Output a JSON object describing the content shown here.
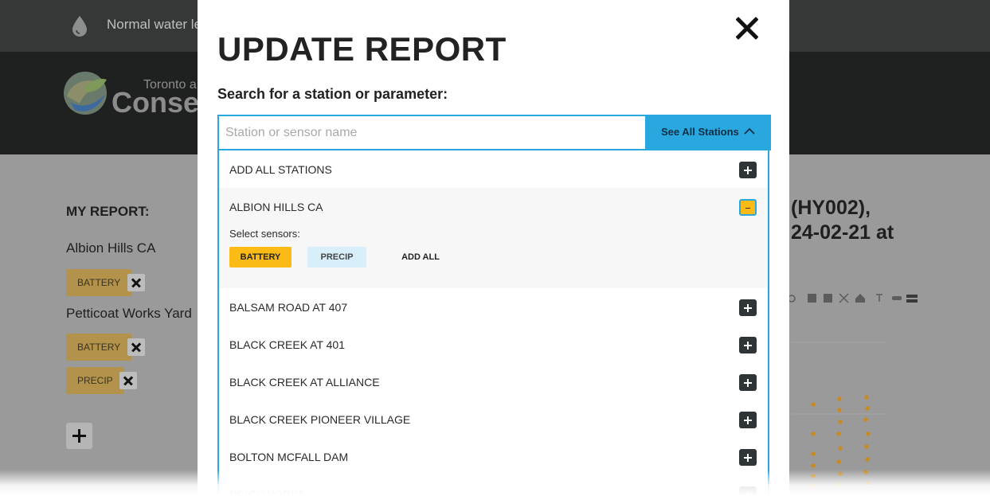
{
  "background": {
    "alert_text": "Normal water le",
    "logo_small": "Toronto a",
    "logo_big": "Conserv",
    "report_heading": "MY REPORT:",
    "report_items": [
      {
        "station": "Albion Hills CA",
        "sensors": [
          "BATTERY"
        ]
      },
      {
        "station": "Petticoat Works Yard",
        "sensors": [
          "BATTERY",
          "PRECIP"
        ]
      }
    ],
    "chart_title_line1": "(HY002),",
    "chart_title_line2": "24-02-21 at"
  },
  "modal": {
    "title": "UPDATE REPORT",
    "search_label": "Search for a station or parameter:",
    "search_placeholder": "Station or sensor name",
    "search_value": "",
    "see_all_label": "See All Stations",
    "add_all_stations": "ADD ALL STATIONS",
    "expanded_station": {
      "name": "ALBION HILLS CA",
      "sensors_label": "Select sensors:",
      "sensors": [
        "BATTERY",
        "PRECIP"
      ],
      "add_all_label": "ADD ALL"
    },
    "stations": [
      "BALSAM ROAD AT 407",
      "BLACK CREEK AT 401",
      "BLACK CREEK AT ALLIANCE",
      "BLACK CREEK PIONEER VILLAGE",
      "BOLTON MCFALL DAM",
      "BRICKWORKS"
    ]
  },
  "icons": {
    "alert": "water-drop-icon",
    "close": "close-icon",
    "dropdown": "chevron-up-icon",
    "row_add": "plus-icon",
    "row_remove": "minus-icon"
  },
  "colors": {
    "accent_blue": "#29a8e0",
    "selected_yellow": "#fbba15",
    "precip_chip": "#d8effb",
    "dark_button": "#2f3436"
  }
}
